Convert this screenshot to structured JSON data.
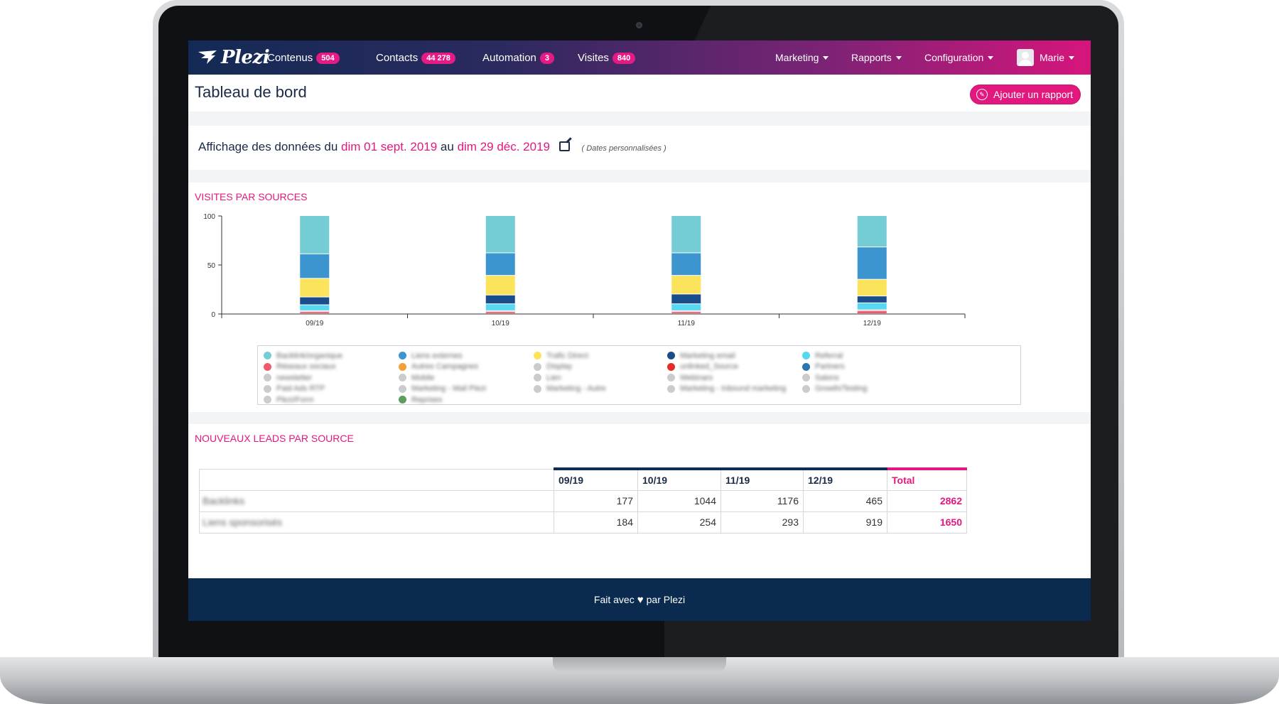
{
  "app": {
    "logo": "Plezi",
    "nav": [
      {
        "label": "Contenus",
        "count": "504"
      },
      {
        "label": "Contacts",
        "count": "44 278"
      },
      {
        "label": "Automation",
        "count": "3"
      },
      {
        "label": "Visites",
        "count": "840"
      }
    ],
    "menus": [
      "Marketing",
      "Rapports",
      "Configuration"
    ],
    "user": "Marie"
  },
  "page": {
    "title": "Tableau de bord",
    "add_report": "Ajouter un rapport"
  },
  "daterange": {
    "prefix": "Affichage des données du",
    "from": "dim 01 sept. 2019",
    "between": "au",
    "to": "dim 29 déc. 2019",
    "note": "( Dates personnalisées )"
  },
  "visits_card": {
    "title": "VISITES PAR SOURCES"
  },
  "legend_blurred": [
    [
      "Backlink/organique",
      "Réseaux sociaux",
      "newsletter",
      "Paid Ads RTP",
      "Plezi/Form"
    ],
    [
      "Liens externes",
      "Autres Campagnes",
      "Mobile",
      "Marketing - Mail Plezi",
      "Reprises"
    ],
    [
      "Trafic Direct",
      "Display",
      "Lien",
      "Marketing - Autre"
    ],
    [
      "Marketing email",
      "unlinked_Source",
      "Webinars",
      "Marketing - Inbound marketing"
    ],
    [
      "Referral",
      "Partners",
      "Salons",
      "Growth/Testing"
    ]
  ],
  "chart_data": {
    "type": "bar",
    "stacked": true,
    "categories": [
      "09/19",
      "10/19",
      "11/19",
      "12/19"
    ],
    "ylim": [
      0,
      100
    ],
    "yticks": [
      0,
      50,
      100
    ],
    "series": [
      {
        "color": "#ef5b6b",
        "values": [
          2,
          2,
          2,
          3
        ]
      },
      {
        "color": "#f0848f",
        "values": [
          1,
          1,
          1,
          1
        ]
      },
      {
        "color": "#56d8f2",
        "values": [
          6,
          7,
          7,
          7
        ]
      },
      {
        "color": "#1b4c8c",
        "values": [
          8,
          9,
          10,
          7
        ]
      },
      {
        "color": "#fbe35c",
        "values": [
          19,
          20,
          19,
          17
        ]
      },
      {
        "color": "#3d95cf",
        "values": [
          25,
          23,
          23,
          33
        ]
      },
      {
        "color": "#74ccd5",
        "values": [
          39,
          38,
          38,
          32
        ]
      }
    ],
    "legend": {
      "placement": "bottom",
      "colors": [
        [
          "#74ccd5",
          "#ef5b6b",
          "#cccccc",
          "#cccccc",
          "#cccccc"
        ],
        [
          "#3d95cf",
          "#f4a03a",
          "#cccccc",
          "#cccccc",
          "#5e9e5c"
        ],
        [
          "#fbe35c",
          "#cccccc",
          "#cccccc",
          "#cccccc"
        ],
        [
          "#1b4c8c",
          "#e62b2b",
          "#cccccc",
          "#cccccc"
        ],
        [
          "#56d8f2",
          "#2c75b0",
          "#cccccc",
          "#cccccc"
        ]
      ]
    }
  },
  "leads_card": {
    "title": "NOUVEAUX LEADS PAR SOURCE",
    "columns": [
      "",
      "09/19",
      "10/19",
      "11/19",
      "12/19",
      "Total"
    ],
    "rows": [
      {
        "source": "Backlinks",
        "values": [
          "177",
          "1044",
          "1176",
          "465"
        ],
        "total": "2862"
      },
      {
        "source": "Liens sponsorisés",
        "values": [
          "184",
          "254",
          "293",
          "919"
        ],
        "total": "1650"
      }
    ]
  },
  "footer": {
    "before": "Fait avec",
    "after": "par Plezi"
  }
}
